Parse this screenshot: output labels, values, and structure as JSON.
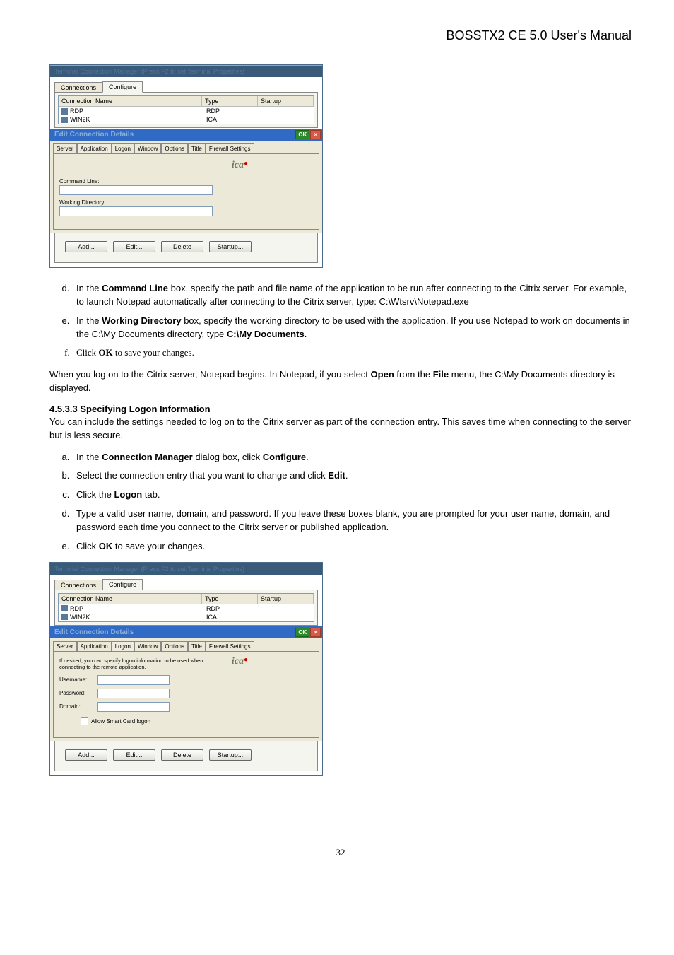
{
  "header_title": "BOSSTX2 CE 5.0 User's Manual",
  "tcm": {
    "window_title": "Terminal Connection Manager (Press F2 to set Terminal Properties)",
    "tabs": {
      "t1": "Connections",
      "t2": "Configure"
    },
    "list": {
      "hdr_name": "Connection Name",
      "hdr_type": "Type",
      "hdr_startup": "Startup",
      "r1_name": "RDP",
      "r1_type": "RDP",
      "r2_name": "WIN2K",
      "r2_type": "ICA"
    },
    "btn_add": "Add...",
    "btn_edit": "Edit...",
    "btn_delete": "Delete",
    "btn_startup": "Startup..."
  },
  "dlg": {
    "title": "Edit Connection Details",
    "ok": "OK",
    "x": "×",
    "tabs": {
      "server": "Server",
      "app": "Application",
      "logon": "Logon",
      "window": "Window",
      "options": "Options",
      "title": "Title",
      "fw": "Firewall Settings"
    },
    "ica_logo": "ica"
  },
  "dlg1": {
    "lbl_cmd": "Command Line:",
    "lbl_wd": "Working Directory:"
  },
  "dlg2": {
    "intro": "If desired, you can specify logon information to be used when connecting to the remote application.",
    "lbl_user": "Username:",
    "lbl_pass": "Password:",
    "lbl_domain": "Domain:",
    "chk": "Allow Smart Card logon"
  },
  "content": {
    "d": {
      "letter": "d.",
      "pre": "In the ",
      "b1": "Command Line",
      "mid": " box, specify the path and file name of the application to be run after connecting to the Citrix server. For example, to launch Notepad automatically after connecting to the Citrix server, type: ",
      "tail": "C:\\Wtsrv\\Notepad.exe"
    },
    "e": {
      "pre": "In the ",
      "b1": "Working Directory",
      "mid": " box, specify the working directory to be used with the application. If you use Notepad to work on documents in the C:\\My Documents directory, type ",
      "b2": "C:\\My Documents",
      "tail": "."
    },
    "f": {
      "pre": "Click ",
      "b1": "OK",
      "tail": " to save your changes."
    },
    "para1_a": "When you log on to the Citrix server, Notepad begins. In Notepad, if you select ",
    "para1_b1": "Open",
    "para1_mid": " from the ",
    "para1_b2": "File",
    "para1_tail": " menu, the C:\\My Documents directory is displayed.",
    "sec_title": "4.5.3.3  Specifying Logon Information",
    "sec_intro": "You can include the settings needed to log on to the Citrix server as part of the connection entry. This saves time when connecting to the server but is less secure.",
    "a2": {
      "pre": "In the ",
      "b1": "Connection Manager",
      "mid": " dialog box, click ",
      "b2": "Configure",
      "tail": "."
    },
    "b2": {
      "pre": "Select the connection entry that you want to change and click ",
      "b1": "Edit",
      "tail": "."
    },
    "c2": {
      "pre": "Click the ",
      "b1": "Logon",
      "tail": " tab."
    },
    "d2": "Type a valid user name, domain, and password. If you leave these boxes blank, you are prompted for your user name, domain, and password each time you connect to the Citrix server or published application.",
    "e2": {
      "pre": "Click ",
      "b1": "OK",
      "tail": " to save your changes."
    }
  },
  "page_num": "32"
}
